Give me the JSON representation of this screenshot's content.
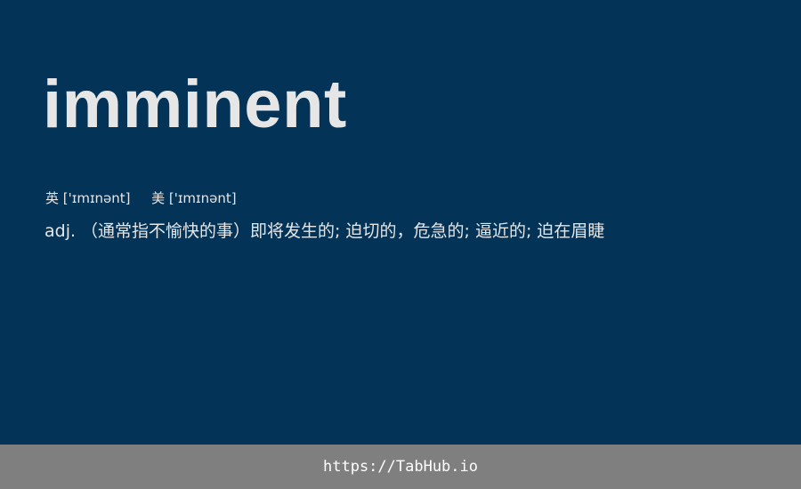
{
  "word": "imminent",
  "pronunciation": {
    "uk_label": "英",
    "uk_ipa": "['ɪmɪnənt]",
    "us_label": "美",
    "us_ipa": "['ɪmɪnənt]"
  },
  "definition": "adj. （通常指不愉快的事）即将发生的; 迫切的，危急的; 逼近的; 迫在眉睫",
  "footer": {
    "url": "https://TabHub.io"
  },
  "colors": {
    "background": "#043358",
    "footer_background": "#7f7f7f",
    "text": "#e6e6e6"
  }
}
